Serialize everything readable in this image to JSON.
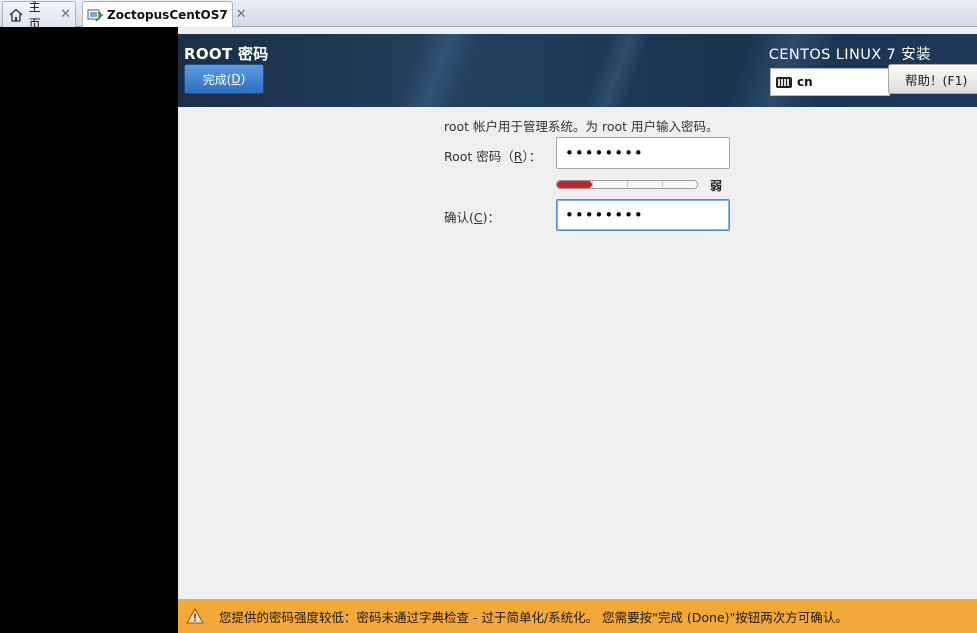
{
  "host_tabs": [
    {
      "label": "主页",
      "active": false
    },
    {
      "label": "ZoctopusCentOS7",
      "active": true
    }
  ],
  "header": {
    "page_title": "ROOT 密码",
    "done_button": {
      "text": "完成(",
      "mnemonic": "D",
      "text_end": ")"
    },
    "product_title": "CENTOS LINUX 7 安装",
    "keyboard_layout": "cn",
    "help_button": {
      "text": "帮助！(F1)"
    }
  },
  "form": {
    "intro": "root 帐户用于管理系统。为 root 用户输入密码。",
    "root_password": {
      "label_pre": "Root 密码（",
      "mnemonic": "R",
      "label_post": "）：",
      "value": "••••••••"
    },
    "strength": {
      "level": 0.25,
      "label": "弱",
      "color": "#c0262b"
    },
    "confirm": {
      "label_pre": "确认(",
      "mnemonic": "C",
      "label_post": ")：",
      "value": "••••••••"
    }
  },
  "warning": {
    "message": "您提供的密码强度较低：密码未通过字典检查 - 过于简单化/系统化。 您需要按\"完成 (Done)\"按钮两次方可确认。",
    "color": "#f3a93a"
  }
}
